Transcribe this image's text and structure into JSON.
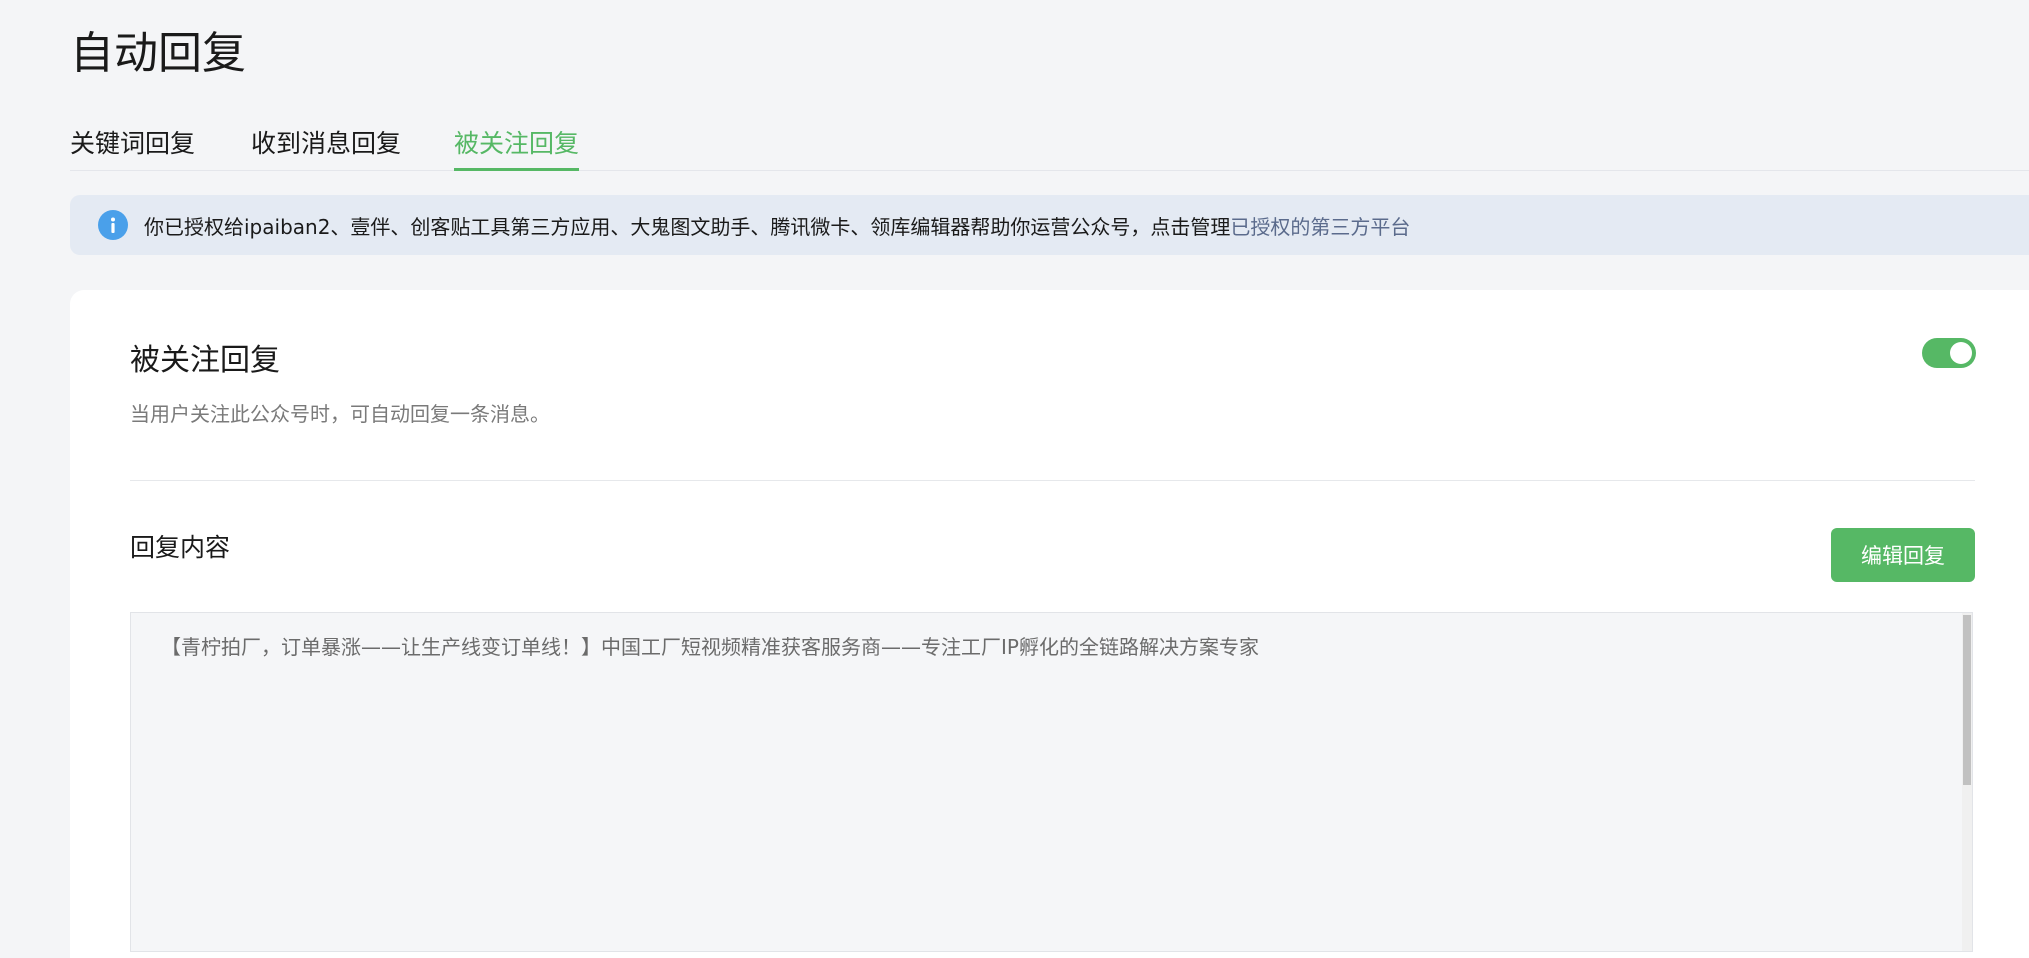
{
  "page": {
    "title": "自动回复"
  },
  "tabs": [
    {
      "label": "关键词回复",
      "active": false
    },
    {
      "label": "收到消息回复",
      "active": false
    },
    {
      "label": "被关注回复",
      "active": true
    }
  ],
  "notice": {
    "icon": "info-icon",
    "text": "你已授权给ipaiban2、壹伴、创客贴工具第三方应用、大鬼图文助手、腾讯微卡、领库编辑器帮助你运营公众号，点击管理",
    "link_label": "已授权的第三方平台"
  },
  "section": {
    "title": "被关注回复",
    "description": "当用户关注此公众号时，可自动回复一条消息。",
    "toggle_on": true
  },
  "reply": {
    "label": "回复内容",
    "edit_button_label": "编辑回复",
    "content": "【青柠拍厂，订单暴涨——让生产线变订单线！】中国工厂短视频精准获客服务商——专注工厂IP孵化的全链路解决方案专家"
  },
  "colors": {
    "accent": "#56b865",
    "notice_bg": "#e4eaf3",
    "info_icon": "#4aa0ea",
    "link": "#5b6b8c"
  }
}
